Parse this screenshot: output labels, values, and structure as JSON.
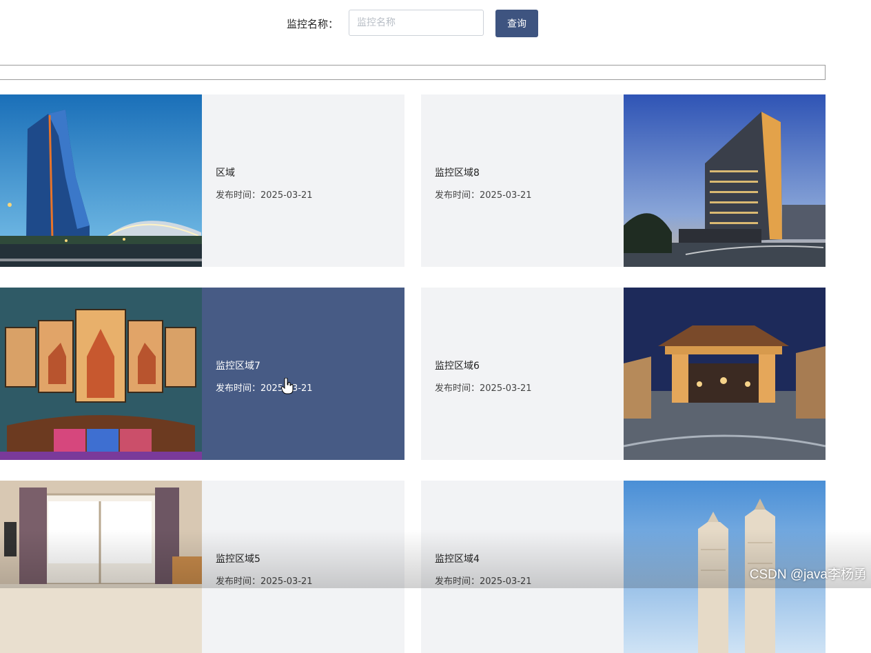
{
  "search": {
    "label": "监控名称：",
    "placeholder": "监控名称",
    "value": "",
    "button_label": "查询"
  },
  "colors": {
    "accent": "#3e5480",
    "card_active_bg": "#475b85",
    "card_bg": "#f2f3f5"
  },
  "cards": [
    {
      "title": "区域",
      "date_prefix": "发布时间：",
      "date": "2025-03-21",
      "image": "hotel-tower-image"
    },
    {
      "title": "监控区域8",
      "date_prefix": "发布时间：",
      "date": "2025-03-21",
      "image": "hotel-building-night-image"
    },
    {
      "title": "监控区域7",
      "date_prefix": "发布时间：",
      "date": "2025-03-21",
      "image": "room-interior-painting-image",
      "active": true
    },
    {
      "title": "监控区域6",
      "date_prefix": "发布时间：",
      "date": "2025-03-21",
      "image": "resort-gate-night-image"
    },
    {
      "title": "监控区域5",
      "date_prefix": "发布时间：",
      "date": "2025-03-21",
      "image": "bedroom-window-image"
    },
    {
      "title": "监控区域4",
      "date_prefix": "发布时间：",
      "date": "2025-03-21",
      "image": "twin-towers-image"
    }
  ],
  "watermark": "CSDN @java李杨勇"
}
